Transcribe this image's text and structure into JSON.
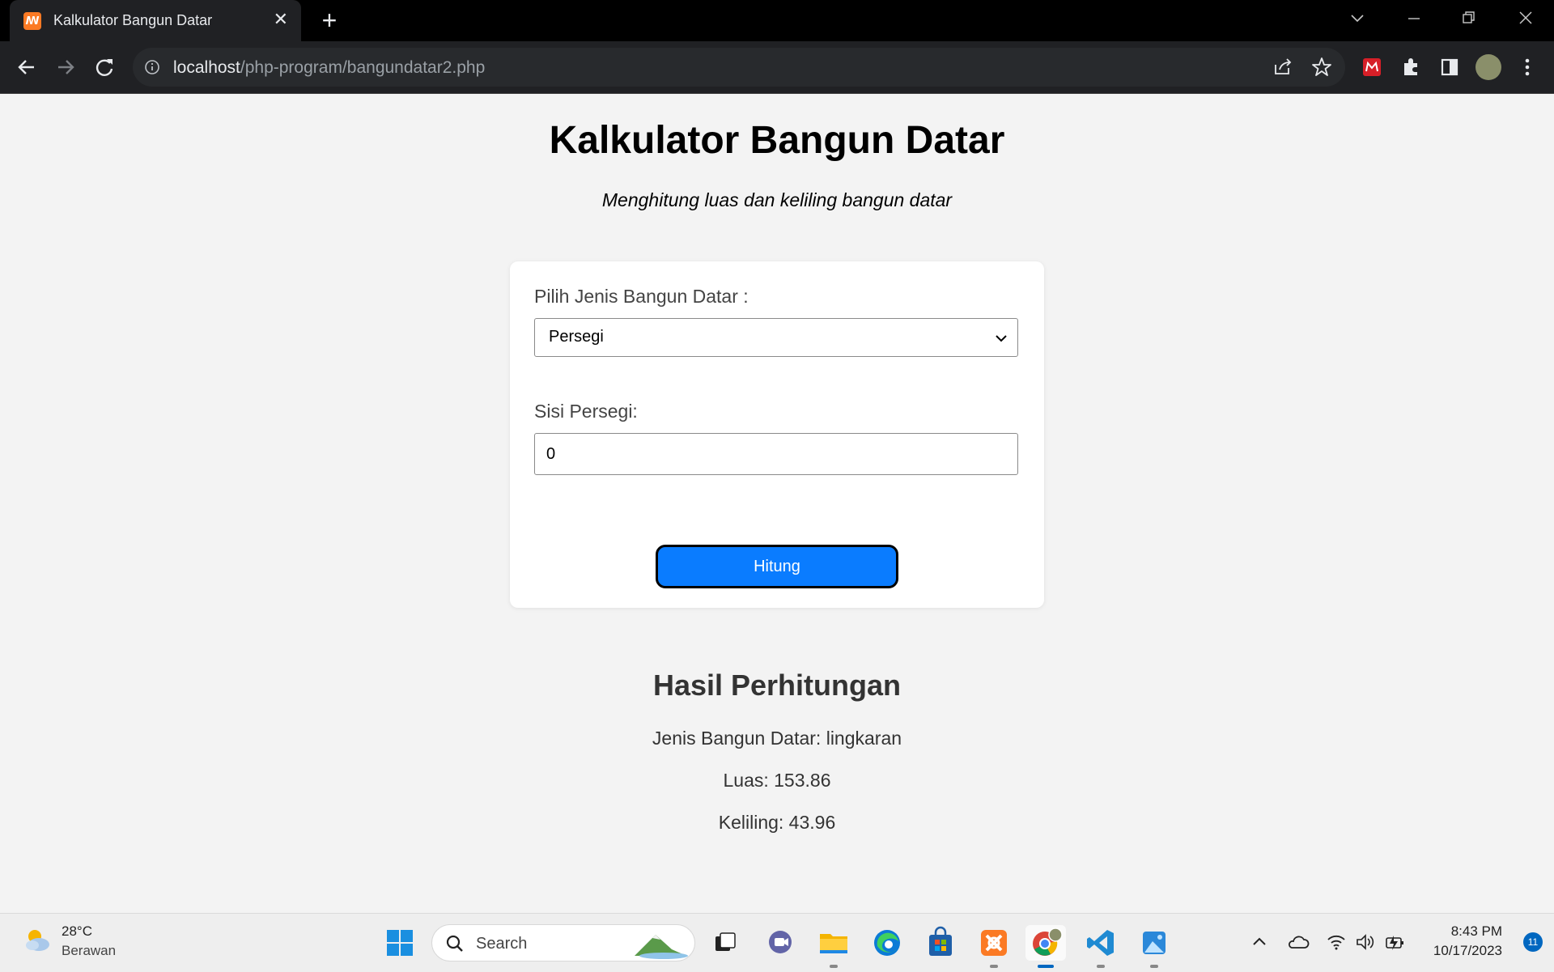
{
  "browser": {
    "tab_title": "Kalkulator Bangun Datar",
    "tab_close": "✕",
    "new_tab": "+",
    "url_host": "localhost",
    "url_path": "/php-program/bangundatar2.php"
  },
  "page": {
    "title": "Kalkulator Bangun Datar",
    "subtitle": "Menghitung luas dan keliling bangun datar"
  },
  "form": {
    "shape_label": "Pilih Jenis Bangun Datar :",
    "shape_selected": "Persegi",
    "side_label": "Sisi Persegi:",
    "side_value": "0",
    "submit_label": "Hitung"
  },
  "result": {
    "title": "Hasil Perhitungan",
    "type_line": "Jenis Bangun Datar: lingkaran",
    "area_line": "Luas: 153.86",
    "perimeter_line": "Keliling: 43.96"
  },
  "taskbar": {
    "temperature": "28°C",
    "condition": "Berawan",
    "search_label": "Search",
    "time": "8:43 PM",
    "date": "10/17/2023",
    "notification_count": "11"
  },
  "colors": {
    "accent_button": "#0a7cff",
    "page_bg": "#f3f3f3",
    "chrome_bg": "#202124"
  }
}
